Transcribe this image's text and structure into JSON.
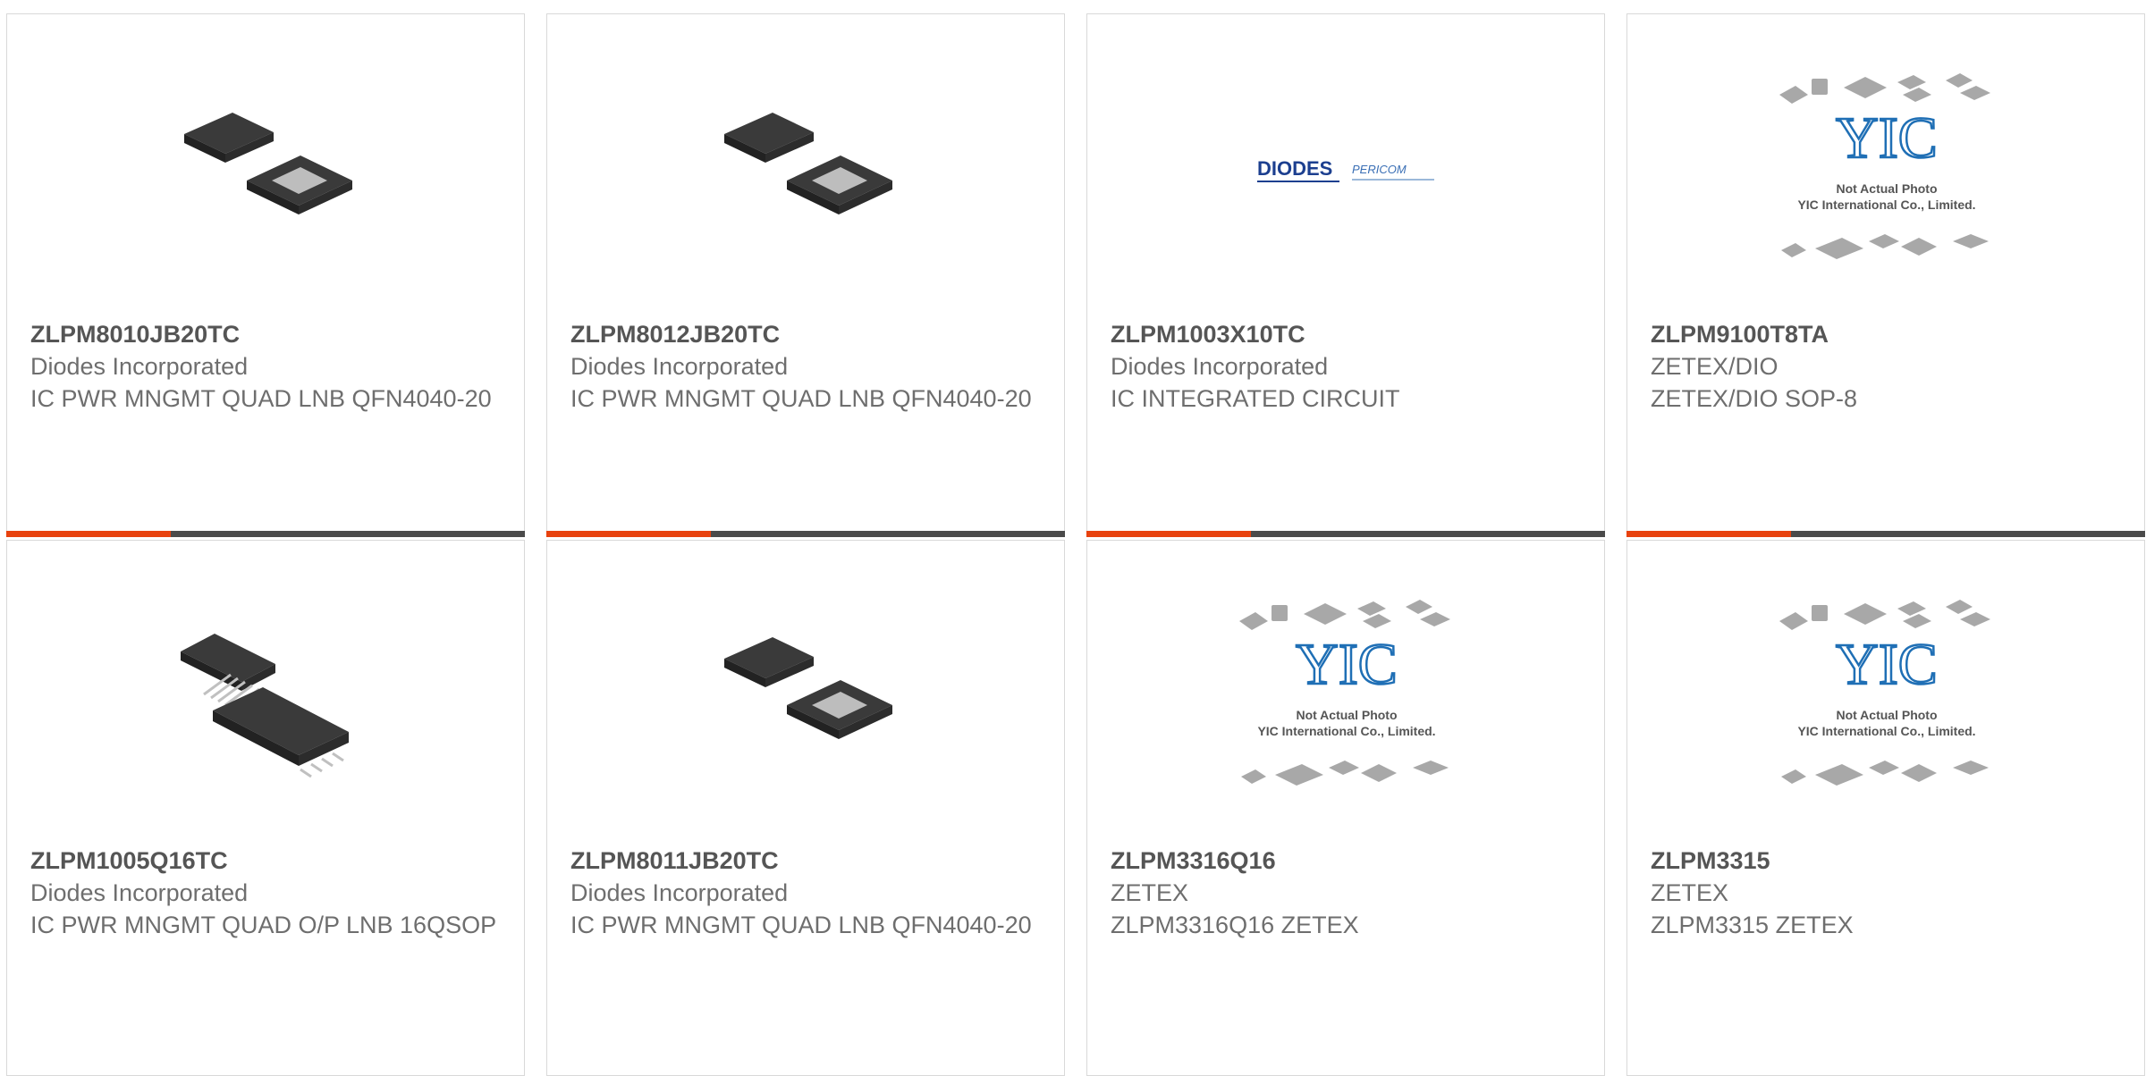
{
  "colors": {
    "accent": "#e8420e",
    "bar": "#4a4a4a",
    "border": "#d9d9d9"
  },
  "products": [
    {
      "part": "ZLPM8010JB20TC",
      "mfr": "Diodes Incorporated",
      "desc": "IC PWR MNGMT QUAD LNB QFN4040-20",
      "image": "qfn-chip-icon"
    },
    {
      "part": "ZLPM8012JB20TC",
      "mfr": "Diodes Incorporated",
      "desc": "IC PWR MNGMT QUAD LNB QFN4040-20",
      "image": "qfn-chip-icon"
    },
    {
      "part": "ZLPM1003X10TC",
      "mfr": "Diodes Incorporated",
      "desc": "IC INTEGRATED CIRCUIT",
      "image": "diodes-pericom-logo",
      "logo_text": [
        "DIODES",
        "PERICOM"
      ]
    },
    {
      "part": "ZLPM9100T8TA",
      "mfr": "ZETEX/DIO",
      "desc": "ZETEX/DIO SOP-8",
      "image": "yic-placeholder",
      "placeholder_text": [
        "YIC",
        "Not Actual Photo",
        "YIC International Co., Limited."
      ]
    },
    {
      "part": "ZLPM1005Q16TC",
      "mfr": "Diodes Incorporated",
      "desc": "IC PWR MNGMT QUAD O/P LNB 16QSOP",
      "image": "qsop-chip-icon"
    },
    {
      "part": "ZLPM8011JB20TC",
      "mfr": "Diodes Incorporated",
      "desc": "IC PWR MNGMT QUAD LNB QFN4040-20",
      "image": "qfn-chip-icon"
    },
    {
      "part": "ZLPM3316Q16",
      "mfr": "ZETEX",
      "desc": "ZLPM3316Q16 ZETEX",
      "image": "yic-placeholder",
      "placeholder_text": [
        "YIC",
        "Not Actual Photo",
        "YIC International Co., Limited."
      ]
    },
    {
      "part": "ZLPM3315",
      "mfr": "ZETEX",
      "desc": "ZLPM3315 ZETEX",
      "image": "yic-placeholder",
      "placeholder_text": [
        "YIC",
        "Not Actual Photo",
        "YIC International Co., Limited."
      ]
    }
  ]
}
